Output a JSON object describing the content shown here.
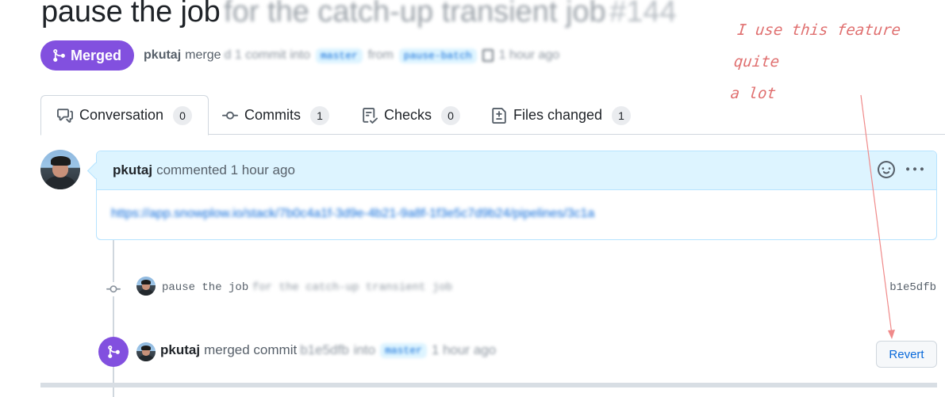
{
  "pr": {
    "title": "pause the job",
    "title_blurred": "for the catch-up transient job",
    "number": "#144",
    "status": "Merged",
    "author": "pkutaj",
    "merge_text": "merge",
    "merge_blurred": "d 1 commit into",
    "base_branch": "master",
    "from_text": "from",
    "head_branch": "pause-batch",
    "time": "1 hour ago"
  },
  "annotation": {
    "line1": "I use this feature quite",
    "line2": "a lot"
  },
  "tabs": [
    {
      "label": "Conversation",
      "count": "0"
    },
    {
      "label": "Commits",
      "count": "1"
    },
    {
      "label": "Checks",
      "count": "0"
    },
    {
      "label": "Files changed",
      "count": "1"
    }
  ],
  "comment": {
    "author": "pkutaj",
    "action": "commented",
    "time": "1 hour ago",
    "body": "https://app.snowplow.io/stack/7b0c4a1f-3d9e-4b21-9a8f-1f3e5c7d9b24/pipelines/3c1a"
  },
  "commit": {
    "message": "pause the job",
    "message_blurred": "for the catch-up transient job",
    "sha": "b1e5dfb"
  },
  "merge_event": {
    "author": "pkutaj",
    "text": "merged commit",
    "sha_blurred": "b1e5dfb",
    "into": "into",
    "branch": "master",
    "time": "1 hour ago",
    "revert_label": "Revert"
  },
  "colors": {
    "merged": "#8250df",
    "link": "#0969da",
    "annotation": "#e07070"
  }
}
